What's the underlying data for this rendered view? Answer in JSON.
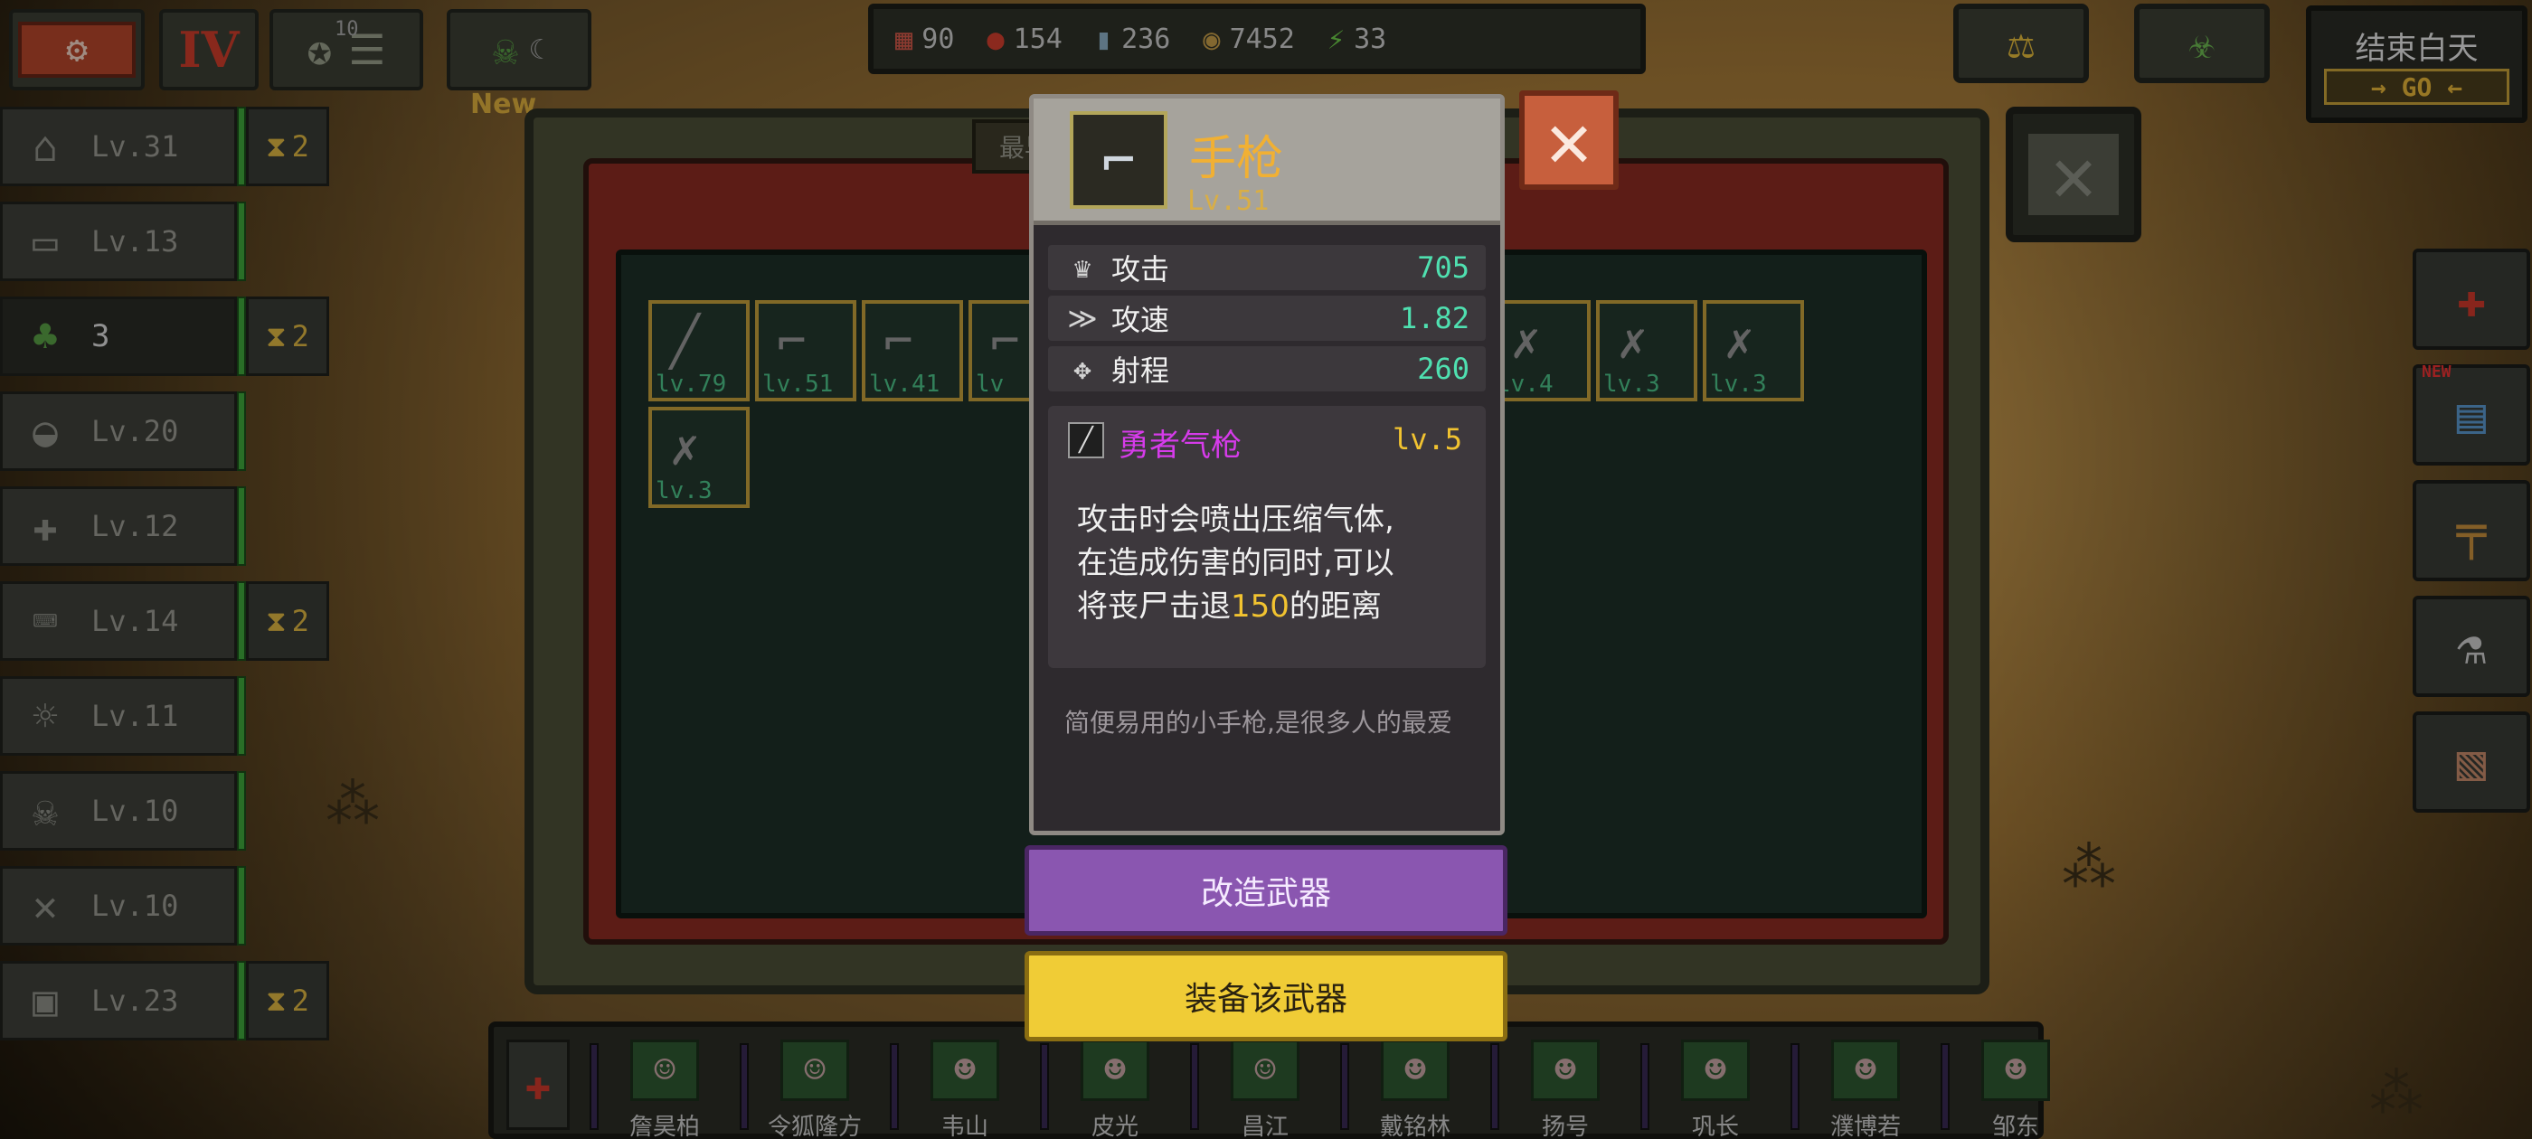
{
  "top_left": {
    "roman": "IV",
    "medal_count": "10",
    "new_tag": "New"
  },
  "resources": [
    {
      "icon": "calendar-icon",
      "glyph": "▦",
      "value": "90",
      "color": "#d45a4a"
    },
    {
      "icon": "apple-icon",
      "glyph": "●",
      "value": "154",
      "color": "#d6402e"
    },
    {
      "icon": "water-bottle-icon",
      "glyph": "▮",
      "value": "236",
      "color": "#8fb3c9"
    },
    {
      "icon": "coins-icon",
      "glyph": "◉",
      "value": "7452",
      "color": "#c9a04a"
    },
    {
      "icon": "energy-icon",
      "glyph": "⚡",
      "value": "33",
      "color": "#6fd04b"
    }
  ],
  "end_day": {
    "label": "结束白天",
    "go": "→ GO ←"
  },
  "sidebar": [
    {
      "name": "house",
      "glyph": "⌂",
      "level": "Lv.31",
      "timer": "2"
    },
    {
      "name": "bed",
      "glyph": "▭",
      "level": "Lv.13",
      "timer": ""
    },
    {
      "name": "plant",
      "glyph": "♣",
      "level": "3",
      "timer": "2",
      "active": true
    },
    {
      "name": "kitchen",
      "glyph": "◒",
      "level": "Lv.20",
      "timer": ""
    },
    {
      "name": "medkit",
      "glyph": "✚",
      "level": "Lv.12",
      "timer": ""
    },
    {
      "name": "workbench",
      "glyph": "⌨",
      "level": "Lv.14",
      "timer": "2"
    },
    {
      "name": "radio",
      "glyph": "☼",
      "level": "Lv.11",
      "timer": ""
    },
    {
      "name": "gasmask",
      "glyph": "☠",
      "level": "Lv.10",
      "timer": ""
    },
    {
      "name": "weapons",
      "glyph": "✕",
      "level": "Lv.10",
      "timer": ""
    },
    {
      "name": "battery",
      "glyph": "▣",
      "level": "Lv.23",
      "timer": "2"
    }
  ],
  "inventory": {
    "sort_label": "最早",
    "slots": [
      {
        "glyph": "╱",
        "lv": "lv.79"
      },
      {
        "glyph": "⌐",
        "lv": "lv.51"
      },
      {
        "glyph": "⌐",
        "lv": "lv.41"
      },
      {
        "glyph": "⌐",
        "lv": "lv"
      },
      {
        "glyph": "✗",
        "lv": "lv.4"
      },
      {
        "glyph": "✗",
        "lv": "lv.3"
      },
      {
        "glyph": "✗",
        "lv": "lv.3"
      },
      {
        "glyph": "✗",
        "lv": "lv.3"
      }
    ]
  },
  "weapon_card": {
    "icon": "pistol-icon",
    "name": "手枪",
    "level": "Lv.51",
    "stats": [
      {
        "icon": "attack-icon",
        "glyph": "♛",
        "label": "攻击",
        "value": "705"
      },
      {
        "icon": "speed-icon",
        "glyph": "≫",
        "label": "攻速",
        "value": "1.82"
      },
      {
        "icon": "range-icon",
        "glyph": "✥",
        "label": "射程",
        "value": "260"
      }
    ],
    "skill": {
      "name": "勇者气枪",
      "level": "lv.5",
      "desc_line1": "攻击时会喷出压缩气体,",
      "desc_line2": "在造成伤害的同时,可以",
      "desc_line3_pre": "将丧尸击退",
      "desc_line3_num": "150",
      "desc_line3_post": "的距离"
    },
    "flavor": "简便易用的小手枪,是很多人的最爱"
  },
  "buttons": {
    "modify": "改造武器",
    "equip": "装备该武器"
  },
  "crew": [
    {
      "name": "詹昊柏",
      "glyph": "☺"
    },
    {
      "name": "令狐隆方",
      "glyph": "☺"
    },
    {
      "name": "韦山",
      "glyph": "☻"
    },
    {
      "name": "皮光",
      "glyph": "☻"
    },
    {
      "name": "昌江",
      "glyph": "☺"
    },
    {
      "name": "戴铭林",
      "glyph": "☻"
    },
    {
      "name": "扬号",
      "glyph": "☻"
    },
    {
      "name": "巩长",
      "glyph": "☻"
    },
    {
      "name": "濮博若",
      "glyph": "☻"
    },
    {
      "name": "邹东",
      "glyph": "☻"
    }
  ]
}
